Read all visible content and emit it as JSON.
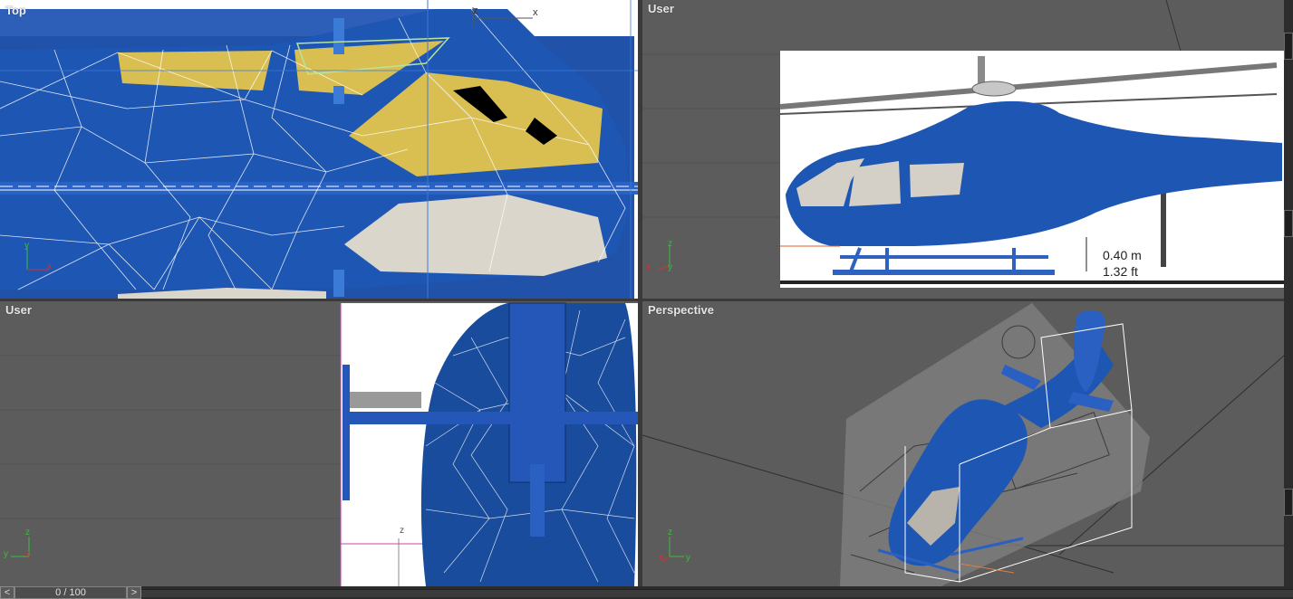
{
  "viewports": {
    "top": {
      "label": "Top"
    },
    "user_right": {
      "label": "User"
    },
    "user_left": {
      "label": "User"
    },
    "perspective": {
      "label": "Perspective"
    }
  },
  "reference_image_text": {
    "line1": "0.40 m",
    "line2": "1.32 ft"
  },
  "axes": {
    "x": "x",
    "y": "y",
    "z": "z"
  },
  "timeline": {
    "frame_display": "0 / 100",
    "prev_glyph": "<",
    "next_glyph": ">"
  },
  "colors": {
    "model_blue": "#1e56b4",
    "accent_yellow": "#d9bf52",
    "viewport_gray": "#5c5c5c"
  }
}
